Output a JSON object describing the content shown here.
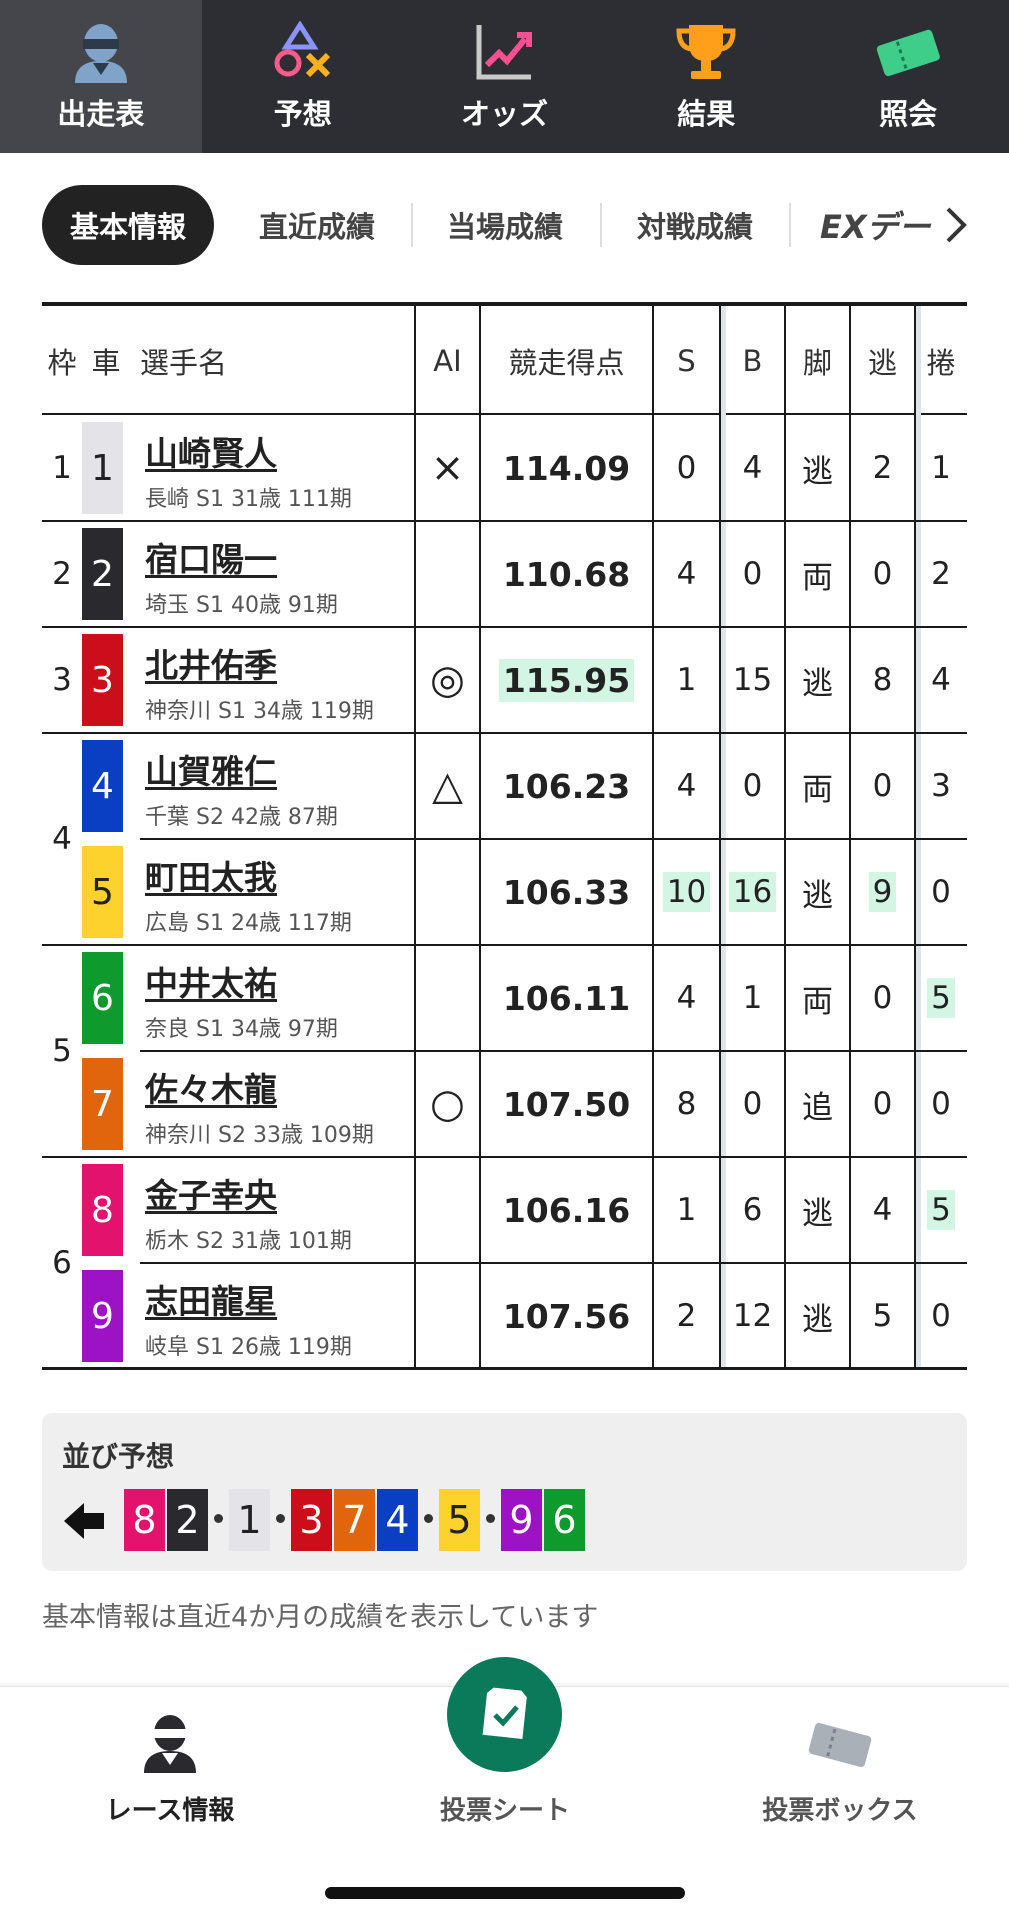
{
  "top_nav": {
    "tabs": [
      {
        "label": "出走表",
        "icon": "racer-icon",
        "active": true
      },
      {
        "label": "予想",
        "icon": "prediction-symbols-icon",
        "active": false
      },
      {
        "label": "オッズ",
        "icon": "odds-chart-icon",
        "active": false
      },
      {
        "label": "結果",
        "icon": "trophy-icon",
        "active": false
      },
      {
        "label": "照会",
        "icon": "ticket-icon",
        "active": false
      }
    ]
  },
  "sub_tabs": {
    "tabs": [
      "基本情報",
      "直近成績",
      "当場成績",
      "対戦成績",
      "EXデー"
    ],
    "active": "基本情報",
    "next_icon": "chevron-right-icon"
  },
  "table": {
    "headers": {
      "waku": "枠",
      "car": "車",
      "name": "選手名",
      "ai": "AI",
      "score": "競走得点",
      "s": "S",
      "b": "B",
      "leg": "脚",
      "nige": "逃",
      "makuri": "捲"
    },
    "waku_labels": [
      {
        "label": "1",
        "rows": 1
      },
      {
        "label": "2",
        "rows": 1
      },
      {
        "label": "3",
        "rows": 1
      },
      {
        "label": "4",
        "rows": 2
      },
      {
        "label": "5",
        "rows": 2
      },
      {
        "label": "6",
        "rows": 2
      }
    ],
    "rows": [
      {
        "car": "1",
        "car_bg": "#e4e4e8",
        "car_fg": "#222222",
        "name": "山崎賢人",
        "meta": "長崎 S1 31歳 111期",
        "ai": "×",
        "score": "114.09",
        "s": "0",
        "b": "4",
        "leg": "逃",
        "nige": "2",
        "makuri": "1",
        "hl": []
      },
      {
        "car": "2",
        "car_bg": "#2a2a2e",
        "car_fg": "#ffffff",
        "name": "宿口陽一",
        "meta": "埼玉 S1 40歳 91期",
        "ai": "",
        "score": "110.68",
        "s": "4",
        "b": "0",
        "leg": "両",
        "nige": "0",
        "makuri": "2",
        "hl": []
      },
      {
        "car": "3",
        "car_bg": "#cc0e1a",
        "car_fg": "#ffffff",
        "name": "北井佑季",
        "meta": "神奈川 S1 34歳 119期",
        "ai": "◎",
        "score": "115.95",
        "s": "1",
        "b": "15",
        "leg": "逃",
        "nige": "8",
        "makuri": "4",
        "hl": [
          "score"
        ]
      },
      {
        "car": "4",
        "car_bg": "#0a3fc4",
        "car_fg": "#ffffff",
        "name": "山賀雅仁",
        "meta": "千葉 S2 42歳 87期",
        "ai": "△",
        "score": "106.23",
        "s": "4",
        "b": "0",
        "leg": "両",
        "nige": "0",
        "makuri": "3",
        "hl": []
      },
      {
        "car": "5",
        "car_bg": "#fed22c",
        "car_fg": "#222222",
        "name": "町田太我",
        "meta": "広島 S1 24歳 117期",
        "ai": "",
        "score": "106.33",
        "s": "10",
        "b": "16",
        "leg": "逃",
        "nige": "9",
        "makuri": "0",
        "hl": [
          "s",
          "b",
          "nige"
        ]
      },
      {
        "car": "6",
        "car_bg": "#0f9a2e",
        "car_fg": "#ffffff",
        "name": "中井太祐",
        "meta": "奈良 S1 34歳 97期",
        "ai": "",
        "score": "106.11",
        "s": "4",
        "b": "1",
        "leg": "両",
        "nige": "0",
        "makuri": "5",
        "hl": [
          "makuri"
        ]
      },
      {
        "car": "7",
        "car_bg": "#e0650c",
        "car_fg": "#ffffff",
        "name": "佐々木龍",
        "meta": "神奈川 S2 33歳 109期",
        "ai": "○",
        "score": "107.50",
        "s": "8",
        "b": "0",
        "leg": "追",
        "nige": "0",
        "makuri": "0",
        "hl": []
      },
      {
        "car": "8",
        "car_bg": "#e3136d",
        "car_fg": "#ffffff",
        "name": "金子幸央",
        "meta": "栃木 S2 31歳 101期",
        "ai": "",
        "score": "106.16",
        "s": "1",
        "b": "6",
        "leg": "逃",
        "nige": "4",
        "makuri": "5",
        "hl": [
          "makuri"
        ]
      },
      {
        "car": "9",
        "car_bg": "#9d12c4",
        "car_fg": "#ffffff",
        "name": "志田龍星",
        "meta": "岐阜 S1 26歳 119期",
        "ai": "",
        "score": "107.56",
        "s": "2",
        "b": "12",
        "leg": "逃",
        "nige": "5",
        "makuri": "0",
        "hl": []
      }
    ]
  },
  "line_prediction": {
    "title": "並び予想",
    "arrow_icon": "arrow-left-icon",
    "chips": [
      {
        "num": "8",
        "bg": "#e3136d",
        "fg": "#ffffff",
        "sep_after": false
      },
      {
        "num": "2",
        "bg": "#2a2a2e",
        "fg": "#ffffff",
        "sep_after": true
      },
      {
        "num": "1",
        "bg": "#e4e4e8",
        "fg": "#222222",
        "sep_after": true
      },
      {
        "num": "3",
        "bg": "#cc0e1a",
        "fg": "#ffffff",
        "sep_after": false
      },
      {
        "num": "7",
        "bg": "#e0650c",
        "fg": "#ffffff",
        "sep_after": false
      },
      {
        "num": "4",
        "bg": "#0a3fc4",
        "fg": "#ffffff",
        "sep_after": true
      },
      {
        "num": "5",
        "bg": "#fed22c",
        "fg": "#222222",
        "sep_after": true
      },
      {
        "num": "9",
        "bg": "#9d12c4",
        "fg": "#ffffff",
        "sep_after": false
      },
      {
        "num": "6",
        "bg": "#0f9a2e",
        "fg": "#ffffff",
        "sep_after": false
      }
    ]
  },
  "note": "基本情報は直近4か月の成績を表示しています",
  "bottom_nav": {
    "items": [
      {
        "label": "レース情報",
        "icon": "racer-icon",
        "active": true
      },
      {
        "label": "投票シート",
        "icon": "check-sheet-icon",
        "active": false
      },
      {
        "label": "投票ボックス",
        "icon": "ticket-box-icon",
        "active": false
      }
    ]
  },
  "colors": {
    "accent": "#0b7a5b",
    "highlight": "#d3f6e4",
    "nav_bg": "#2d2e33"
  }
}
